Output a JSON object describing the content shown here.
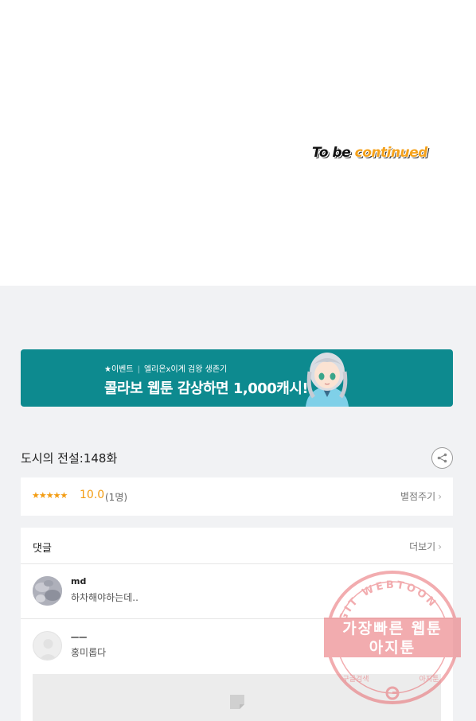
{
  "viewer": {
    "end_text_a": "To be ",
    "end_text_b": "continued"
  },
  "banner": {
    "small_a": "★이벤트",
    "small_b": "엘리온x이계 검왕 생존기",
    "big": "콜라보 웹툰 감상하면 1,000캐시!",
    "character_icon": "anime-character-icon"
  },
  "episode": {
    "title": "도시의 전설:148화",
    "share_icon": "share-icon"
  },
  "rating": {
    "stars": "★★★★★",
    "score": "10.0",
    "count": "(1명)",
    "rate_label": "별점주기"
  },
  "comments": {
    "title": "댓글",
    "more_label": "더보기",
    "items": [
      {
        "name": "md",
        "text": "하차해야하는데.."
      },
      {
        "name": "ㅡㅡ",
        "text": "홍미롭다",
        "has_image": true
      }
    ]
  },
  "watermark": {
    "ring_text": "AGIT WEBTOON",
    "line1": "가장빠른 웹툰",
    "line2": "아지툰",
    "bottom_left": "구글검색",
    "bottom_right": "아지툰",
    "color": "#e8696e"
  },
  "colors": {
    "banner_bg": "#0d8a8f",
    "rating_accent": "#f39c12",
    "page_bg": "#f1f2f4"
  }
}
